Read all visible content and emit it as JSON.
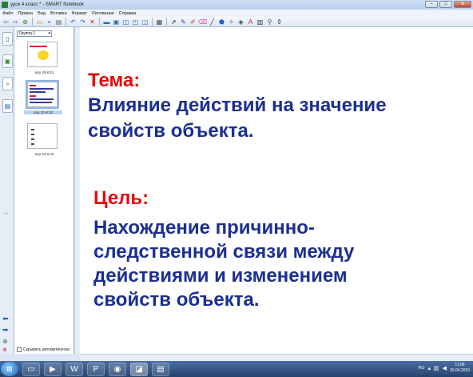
{
  "window": {
    "title": "урок 4 класс * - SMART Notebook",
    "controls": [
      "–",
      "□",
      "x"
    ]
  },
  "menu": [
    "Файл",
    "Правка",
    "Вид",
    "Вставка",
    "Формат",
    "Рисование",
    "Справка"
  ],
  "toolbar": {
    "icons": [
      {
        "name": "back-arrow-icon",
        "glyph": "⇦",
        "color": "#1f5fc4"
      },
      {
        "name": "forward-arrow-icon",
        "glyph": "⇨",
        "color": "#1f5fc4"
      },
      {
        "name": "add-page-icon",
        "glyph": "⊕",
        "color": "#2e8b3e"
      },
      {
        "name": "open-folder-icon",
        "glyph": "▭",
        "color": "#c8911c"
      },
      {
        "name": "save-icon",
        "glyph": "▪",
        "color": "#3a55a8"
      },
      {
        "name": "paste-icon",
        "glyph": "▤",
        "color": "#6b6b6b"
      },
      {
        "name": "undo-icon",
        "glyph": "↶",
        "color": "#1f5fc4"
      },
      {
        "name": "redo-icon",
        "glyph": "↷",
        "color": "#1f5fc4"
      },
      {
        "name": "delete-icon",
        "glyph": "✕",
        "color": "#d22121"
      },
      {
        "name": "screen-shade-icon",
        "glyph": "▬",
        "color": "#2a63c0"
      },
      {
        "name": "full-screen-icon",
        "glyph": "▣",
        "color": "#2a63c0"
      },
      {
        "name": "dual-page-icon",
        "glyph": "◫",
        "color": "#2a63c0"
      },
      {
        "name": "capture-icon",
        "glyph": "◰",
        "color": "#2a63c0"
      },
      {
        "name": "document-camera-icon",
        "glyph": "◲",
        "color": "#2a63c0"
      },
      {
        "name": "table-icon",
        "glyph": "▦",
        "color": "#4b4b4b"
      },
      {
        "name": "select-arrow-icon",
        "glyph": "➚",
        "color": "#111"
      },
      {
        "name": "pen-icon",
        "glyph": "✎",
        "color": "#3b2b8f"
      },
      {
        "name": "creative-pen-icon",
        "glyph": "✐",
        "color": "#b3402c"
      },
      {
        "name": "eraser-icon",
        "glyph": "⌫",
        "color": "#d34b8f"
      },
      {
        "name": "line-icon",
        "glyph": "╱",
        "color": "#333"
      },
      {
        "name": "shape-icon",
        "glyph": "⬟",
        "color": "#1f5fc4"
      },
      {
        "name": "magic-pen-icon",
        "glyph": "✧",
        "color": "#b4148a"
      },
      {
        "name": "fill-icon",
        "glyph": "◈",
        "color": "#333"
      },
      {
        "name": "text-icon",
        "glyph": "A",
        "color": "#c41e1e"
      },
      {
        "name": "properties-icon",
        "glyph": "▥",
        "color": "#333"
      },
      {
        "name": "measure-icon",
        "glyph": "⚲",
        "color": "#555"
      },
      {
        "name": "more-tools-icon",
        "glyph": "⇕",
        "color": "#333"
      }
    ]
  },
  "sidebar": {
    "group": "Группа 1",
    "thumbnails": [
      {
        "label": "апр 20-8:51",
        "selected": false
      },
      {
        "label": "апр 20-8:30",
        "selected": true
      },
      {
        "label": "апр 20-9:42",
        "selected": false
      }
    ],
    "auto_hide_label": "Скрывать автоматически"
  },
  "slide": {
    "topic_heading": "Тема:",
    "topic_lines": [
      "Влияние действий  на значение",
      "свойств объекта."
    ],
    "goal_heading": "Цель:",
    "goal_lines": [
      "Нахождение причинно-",
      "следственной связи между",
      "действиями и изменением",
      "свойств объекта."
    ],
    "heading_color": "#e20b0b",
    "body_color": "#1b2f91"
  },
  "taskbar": {
    "apps": [
      {
        "name": "explorer-icon",
        "glyph": "▭"
      },
      {
        "name": "media-player-icon",
        "glyph": "▶"
      },
      {
        "name": "word-icon",
        "glyph": "W"
      },
      {
        "name": "presentation-icon",
        "glyph": "P"
      },
      {
        "name": "chrome-icon",
        "glyph": "◉"
      },
      {
        "name": "smart-notebook-icon",
        "glyph": "◪"
      },
      {
        "name": "smart-board-icon",
        "glyph": "▤"
      }
    ],
    "language": "RU",
    "time": "11:05",
    "date": "20.04.2015"
  }
}
